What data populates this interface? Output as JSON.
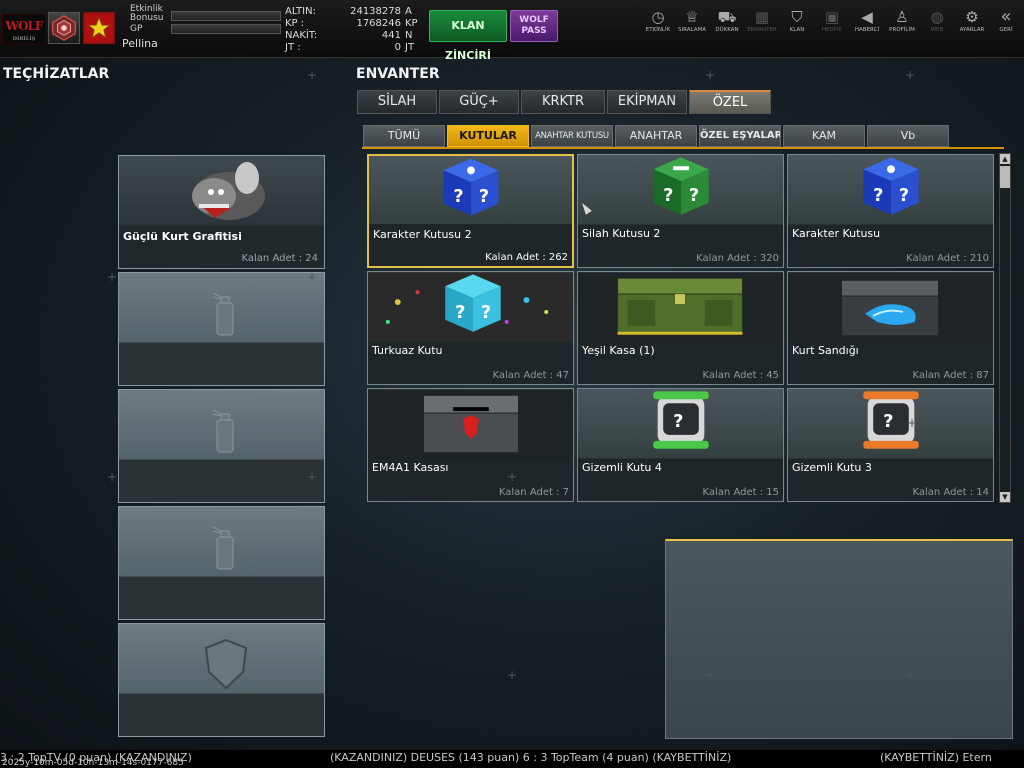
{
  "topbar": {
    "logo_text": "WOLF",
    "logo_sub": "DİRİLİŞ",
    "bonus_label": "Etkinlik Bonusu",
    "gp_label": "GP",
    "player_name": "Pellina",
    "currency": [
      {
        "label": "ALTIN:",
        "value": "24138278",
        "unit": "A"
      },
      {
        "label": "KP :",
        "value": "1768246",
        "unit": "KP"
      },
      {
        "label": "NAKİT:",
        "value": "441",
        "unit": "N"
      },
      {
        "label": "JT :",
        "value": "0",
        "unit": "JT"
      }
    ],
    "klan_btn": "KLAN ZİNCİRİ",
    "wolf_pass": "WOLF PASS",
    "nav": [
      {
        "label": "ETKİNLİK",
        "icon": "timer-icon",
        "glyph": "◷"
      },
      {
        "label": "SIRALAMA",
        "icon": "medal-icon",
        "glyph": "♕"
      },
      {
        "label": "DÜKKAN",
        "icon": "cart-icon",
        "glyph": "⛟"
      },
      {
        "label": "ENVANTER",
        "icon": "inventory-icon",
        "glyph": "▦"
      },
      {
        "label": "KLAN",
        "icon": "shield-icon",
        "glyph": "⛉"
      },
      {
        "label": "HEDİYE",
        "icon": "gift-icon",
        "glyph": "▣"
      },
      {
        "label": "HABERCİ",
        "icon": "megaphone-icon",
        "glyph": "◀"
      },
      {
        "label": "PROFİLİM",
        "icon": "profile-icon",
        "glyph": "♙"
      },
      {
        "label": "WEB",
        "icon": "globe-icon",
        "glyph": "◍"
      },
      {
        "label": "AYARLAR",
        "icon": "gear-icon",
        "glyph": "⚙"
      },
      {
        "label": "GERİ",
        "icon": "back-icon",
        "glyph": "«"
      }
    ]
  },
  "left": {
    "title": "TEÇHİZATLAR",
    "slots": [
      {
        "name": "Güçlü Kurt Grafitisi",
        "count": "Kalan Adet : 24"
      }
    ]
  },
  "inventory": {
    "title": "ENVANTER",
    "tabs": [
      "SİLAH",
      "GÜÇ+",
      "KRKTR",
      "EKİPMAN",
      "ÖZEL"
    ],
    "subtabs": [
      "TÜMÜ",
      "KUTULAR",
      "ANAHTAR KUTUSU",
      "ANAHTAR",
      "ÖZEL EŞYALAR",
      "KAM",
      "Vb"
    ],
    "items": [
      {
        "name": "Karakter Kutusu 2",
        "count": "Kalan Adet : 262"
      },
      {
        "name": "Silah Kutusu 2",
        "count": "Kalan Adet : 320"
      },
      {
        "name": "Karakter Kutusu",
        "count": "Kalan Adet : 210"
      },
      {
        "name": "Turkuaz Kutu",
        "count": "Kalan Adet : 47"
      },
      {
        "name": "Yeşil Kasa (1)",
        "count": "Kalan Adet : 45"
      },
      {
        "name": "Kurt Sandığı",
        "count": "Kalan Adet : 87"
      },
      {
        "name": "EM4A1 Kasası",
        "count": "Kalan Adet : 7"
      },
      {
        "name": "Gizemli Kutu 4",
        "count": "Kalan Adet : 15"
      },
      {
        "name": "Gizemli Kutu 3",
        "count": "Kalan Adet : 14"
      }
    ]
  },
  "ticker": {
    "segments": [
      "(KAZANDINIZ) DEUSES (143 puan) 6 : 3 TopTeam (4 puan) (KAYBETTİNİZ)",
      "(KAYBETTİNİZ) Etern"
    ],
    "lead": "3 : 2  TopTV (0 puan) (KAZANDINIZ)",
    "stamp": "2025y-10m-05d-10h-13m-14s-0177-685"
  },
  "colors": {
    "accent": "#f2b817",
    "selected_border": "#e6bf4a",
    "klan_green": "#1b8a3c",
    "wolfpass_purple": "#7a3a9a",
    "active_tab_top": "#d88a3a"
  }
}
